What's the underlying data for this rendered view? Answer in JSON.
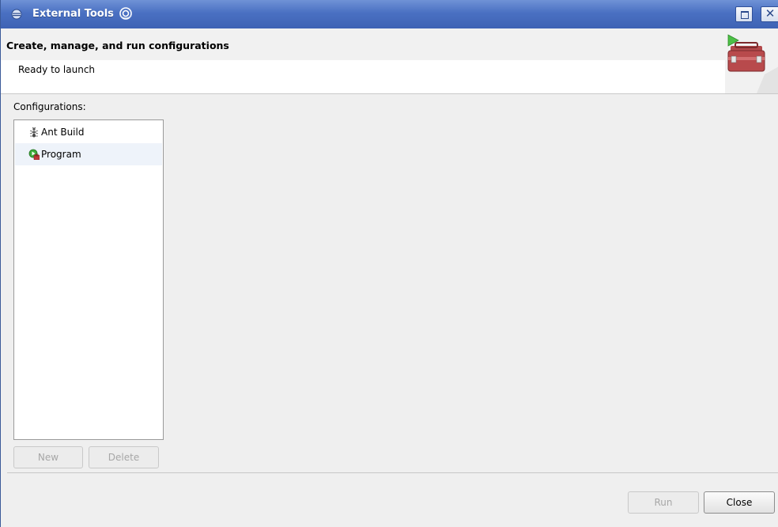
{
  "window": {
    "title": "External Tools",
    "maximize_icon": "maximize-icon",
    "close_label": "✕"
  },
  "banner": {
    "title": "Create, manage, and run configurations",
    "message": "Ready to launch",
    "image_icon": "toolbox-run-icon"
  },
  "configurations": {
    "label": "Configurations:",
    "items": [
      {
        "label": "Ant Build",
        "icon": "ant-icon",
        "selected": false
      },
      {
        "label": "Program",
        "icon": "program-icon",
        "selected": true
      }
    ],
    "new_label": "New",
    "delete_label": "Delete"
  },
  "footer": {
    "run_label": "Run",
    "close_label": "Close"
  }
}
